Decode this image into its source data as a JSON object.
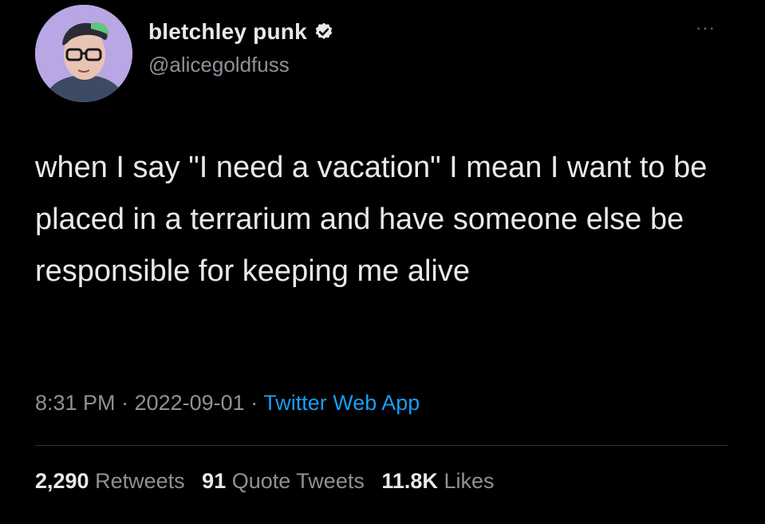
{
  "author": {
    "display_name": "bletchley punk",
    "handle": "@alicegoldfuss",
    "verified": true,
    "avatar_icon": "profile-photo"
  },
  "tweet": {
    "text": "when I say \"I need a vacation\" I mean I want to be placed in a terrarium and have someone else be responsible for keeping me alive",
    "time": "8:31 PM",
    "sep1": " · ",
    "date": "2022-09-01",
    "sep2": " · ",
    "source": "Twitter Web App"
  },
  "stats": {
    "retweets_count": "2,290",
    "retweets_label": "Retweets",
    "quote_count": "91",
    "quote_label": "Quote Tweets",
    "likes_count": "11.8K",
    "likes_label": "Likes"
  },
  "colors": {
    "background": "#000000",
    "text_primary": "#e7e9ea",
    "text_secondary": "#8b9298",
    "link": "#1d9bf0"
  },
  "icons": {
    "verified": "verified-badge-icon",
    "more": "more-options-icon"
  },
  "more_glyph": "···"
}
